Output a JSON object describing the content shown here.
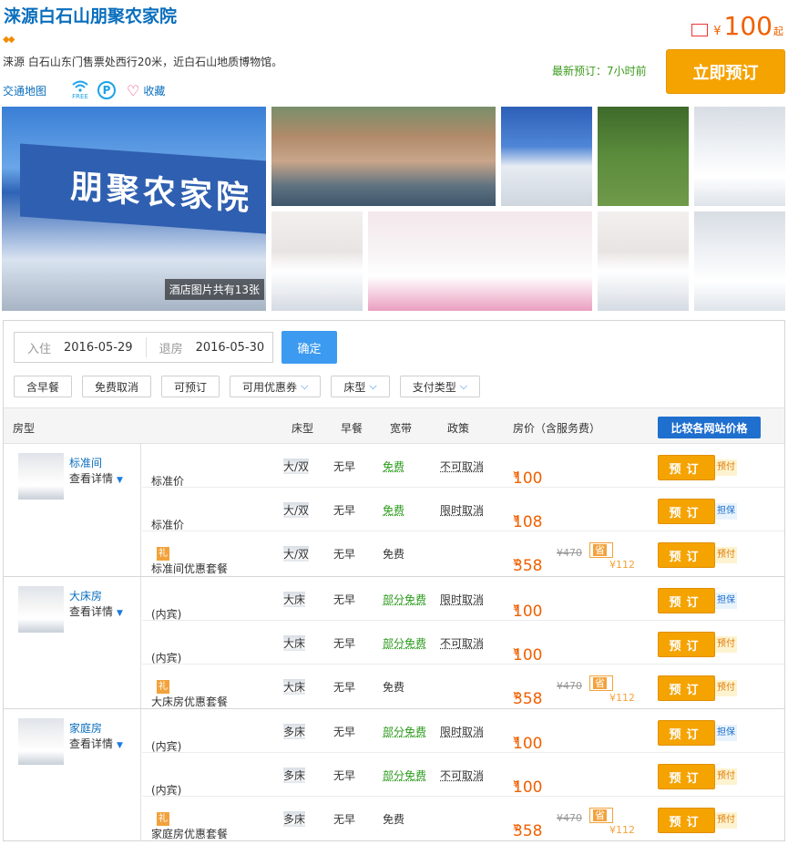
{
  "header": {
    "title": "涞源白石山朋聚农家院",
    "diamonds": "◆◆",
    "address": "涞源 白石山东门售票处西行20米，近白石山地质博物馆。",
    "map_link": "交通地图",
    "wifi_text": "FREE",
    "parking_text": "P",
    "favorite": "收藏",
    "price_yen": "¥",
    "price": "100",
    "price_suffix": "起",
    "latest": "最新预订：7小时前",
    "book_now": "立即预订"
  },
  "photos": {
    "main_sign": "朋聚农家院",
    "caption": "酒店图片共有13张"
  },
  "search": {
    "checkin_label": "入住",
    "checkin": "2016-05-29",
    "checkout_label": "退房",
    "checkout": "2016-05-30",
    "confirm": "确定"
  },
  "filters": [
    {
      "label": "含早餐",
      "dropdown": false
    },
    {
      "label": "免费取消",
      "dropdown": false
    },
    {
      "label": "可预订",
      "dropdown": false
    },
    {
      "label": "可用优惠券",
      "dropdown": true
    },
    {
      "label": "床型",
      "dropdown": true
    },
    {
      "label": "支付类型",
      "dropdown": true
    }
  ],
  "table": {
    "headers": {
      "room": "房型",
      "bed": "床型",
      "breakfast": "早餐",
      "net": "宽带",
      "policy": "政策",
      "price": "房价（含服务费）",
      "compare": "比较各网站价格"
    },
    "groups": [
      {
        "name": "标准间",
        "detail": "查看详情",
        "rows": [
          {
            "plan": "标准价",
            "gift": "",
            "bed": "大/双",
            "bf": "无早",
            "net": "免费",
            "net_green": true,
            "policy": "不可取消",
            "price": "100",
            "orig": "",
            "save": "",
            "pay": "预付",
            "pay_blue": false
          },
          {
            "plan": "标准价",
            "gift": "",
            "bed": "大/双",
            "bf": "无早",
            "net": "免费",
            "net_green": true,
            "policy": "限时取消",
            "price": "108",
            "orig": "",
            "save": "",
            "pay": "担保",
            "pay_blue": true
          },
          {
            "plan": "标准间优惠套餐",
            "gift": "礼",
            "bed": "大/双",
            "bf": "无早",
            "net": "免费",
            "net_green": false,
            "policy": "",
            "price": "358",
            "orig": "¥470",
            "save": "¥112",
            "pay": "预付",
            "pay_blue": false
          }
        ]
      },
      {
        "name": "大床房",
        "detail": "查看详情",
        "rows": [
          {
            "plan": "(内宾)",
            "gift": "",
            "bed": "大床",
            "bf": "无早",
            "net": "部分免费",
            "net_green": true,
            "policy": "限时取消",
            "price": "100",
            "orig": "",
            "save": "",
            "pay": "担保",
            "pay_blue": true
          },
          {
            "plan": "(内宾)",
            "gift": "",
            "bed": "大床",
            "bf": "无早",
            "net": "部分免费",
            "net_green": true,
            "policy": "不可取消",
            "price": "100",
            "orig": "",
            "save": "",
            "pay": "预付",
            "pay_blue": false
          },
          {
            "plan": "大床房优惠套餐",
            "gift": "礼",
            "bed": "大床",
            "bf": "无早",
            "net": "免费",
            "net_green": false,
            "policy": "",
            "price": "358",
            "orig": "¥470",
            "save": "¥112",
            "pay": "预付",
            "pay_blue": false
          }
        ]
      },
      {
        "name": "家庭房",
        "detail": "查看详情",
        "rows": [
          {
            "plan": "(内宾)",
            "gift": "",
            "bed": "多床",
            "bf": "无早",
            "net": "部分免费",
            "net_green": true,
            "policy": "限时取消",
            "price": "100",
            "orig": "",
            "save": "",
            "pay": "担保",
            "pay_blue": true
          },
          {
            "plan": "(内宾)",
            "gift": "",
            "bed": "多床",
            "bf": "无早",
            "net": "部分免费",
            "net_green": true,
            "policy": "不可取消",
            "price": "100",
            "orig": "",
            "save": "",
            "pay": "预付",
            "pay_blue": false
          },
          {
            "plan": "家庭房优惠套餐",
            "gift": "礼",
            "bed": "多床",
            "bf": "无早",
            "net": "免费",
            "net_green": false,
            "policy": "",
            "price": "358",
            "orig": "¥470",
            "save": "¥112",
            "pay": "预付",
            "pay_blue": false
          }
        ]
      }
    ],
    "book_label": "预订",
    "save_prefix": "省",
    "yen": "¥"
  }
}
